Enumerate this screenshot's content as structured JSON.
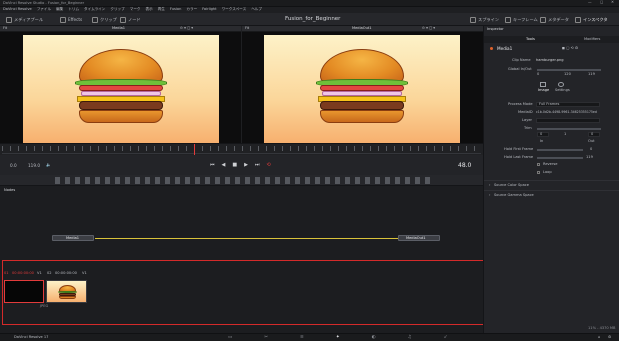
{
  "titlebar": {
    "app_title": "DaVinci Resolve Studio - Fusion_for_Beginner"
  },
  "menubar": {
    "items": [
      "DaVinci Resolve",
      "ファイル",
      "編集",
      "トリム",
      "タイムライン",
      "クリップ",
      "マーク",
      "表示",
      "再生",
      "Fusion",
      "カラー",
      "Fairlight",
      "ワークスペース",
      "ヘルプ"
    ]
  },
  "toolbar": {
    "left": [
      "メディアプール",
      "Effects",
      "クリップ",
      "ノード"
    ],
    "project_title": "Fusion_for_Beginner",
    "right": [
      "スプライン",
      "キーフレーム",
      "メタデータ",
      "インスペクタ"
    ]
  },
  "viewer1": {
    "label": "Media1",
    "left_tag": "Fit",
    "zoom": "Fit"
  },
  "viewer2": {
    "label": "MediaOut1",
    "left_tag": "Fit",
    "zoom": "Fit"
  },
  "transport": {
    "start": "0.0",
    "end": "119.0",
    "frame": "48.0"
  },
  "nodes_panel": {
    "title": "Nodes",
    "node_in": "Media1",
    "node_out": "MediaOut1"
  },
  "timeline": {
    "clip1": {
      "num": "01",
      "tc": "00:00:00:00",
      "track": "V1"
    },
    "clip2": {
      "num": "02",
      "tc": "00:00:00:00",
      "track": "V1"
    },
    "clip_format": "JPEG"
  },
  "inspector": {
    "title": "Inspector",
    "tabs": [
      "Tools",
      "Modifiers"
    ],
    "node_name": "Media1",
    "clip_name_label": "Clip Name",
    "clip_name": "hamburger.png",
    "global_in_out_label": "Global In/Out",
    "global_in": "0",
    "global_mid": "120",
    "global_out": "119",
    "subtabs": [
      "Image",
      "Settings"
    ],
    "process_mode_label": "Process Mode",
    "process_mode": "Full Frames",
    "media_id_label": "MediaID",
    "media_id": "c1b.0d2b-4498-9961-34625355175ed",
    "layer_label": "Layer",
    "trim_label": "Trim",
    "trim_in": "0",
    "trim_mid": "1",
    "trim_out": "0",
    "in_label": "In",
    "out_label": "Out",
    "hold_first_label": "Hold First Frame",
    "hold_first": "0",
    "hold_last_label": "Hold Last Frame",
    "hold_last": "119",
    "reverse_label": "Reverse",
    "loop_label": "Loop",
    "section1": "Source Color Space",
    "section2": "Source Gamma Space"
  },
  "statusbar": {
    "app": "DaVinci Resolve 17",
    "info": "11% - 4370 MB"
  },
  "colors": {
    "accent_red": "#d42a2a",
    "node_line": "#d9c23a",
    "tab_active": "#2a2b2f"
  }
}
